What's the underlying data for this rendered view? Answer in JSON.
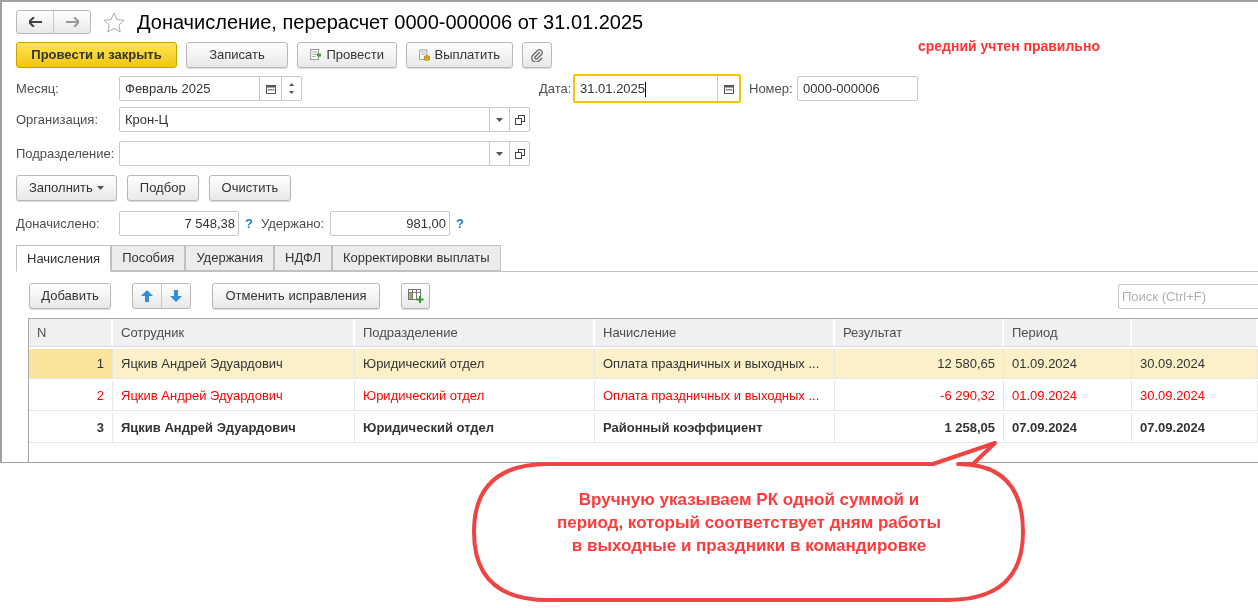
{
  "window": {
    "title": "Доначисление, перерасчет 0000-000006 от 31.01.2025"
  },
  "toolbar": {
    "buttons": [
      {
        "label": "Провести и закрыть",
        "kind": "primary"
      },
      {
        "label": "Записать",
        "kind": "plain"
      },
      {
        "label": "Провести",
        "kind": "post"
      },
      {
        "label": "Выплатить",
        "kind": "pay"
      },
      {
        "kind": "attach"
      }
    ]
  },
  "note": "средний учтен правильно",
  "fields": {
    "month": {
      "label": "Месяц:",
      "value": "Февраль 2025"
    },
    "date": {
      "label": "Дата:",
      "value": "31.01.2025",
      "focused": true
    },
    "number": {
      "label": "Номер:",
      "value": "0000-000006"
    },
    "organization": {
      "label": "Организация:",
      "value": "Крон-Ц"
    },
    "department": {
      "label": "Подразделение:"
    }
  },
  "fill_buttons": [
    {
      "label": "Заполнить",
      "dropdown": true
    },
    {
      "label": "Подбор",
      "dropdown": false
    },
    {
      "label": "Очистить",
      "dropdown": false
    }
  ],
  "totals": [
    {
      "label": "Доначислено:",
      "value": "7 548,38",
      "hint": "?"
    },
    {
      "label": "Удержано:",
      "value": "981,00",
      "hint": "?"
    }
  ],
  "tabs": [
    {
      "label": "Начисления",
      "selected": true
    },
    {
      "label": "Пособия",
      "selected": false
    },
    {
      "label": "Удержания",
      "selected": false
    },
    {
      "label": "НДФЛ",
      "selected": false
    },
    {
      "label": "Корректировки выплаты",
      "selected": false
    }
  ],
  "table_toolbar": {
    "add": "Добавить",
    "undo": "Отменить исправления",
    "search_placeholder": "Поиск (Ctrl+F)"
  },
  "table": {
    "columns": [
      "N",
      "Сотрудник",
      "Подразделение",
      "Начисление",
      "Результат",
      "Период",
      ""
    ],
    "rows": [
      {
        "selected": true,
        "kind": "regular",
        "cells": [
          "1",
          "Яцкив Андрей Эдуардович",
          "Юридический отдел",
          "Оплата праздничных и выходных ...",
          "12 580,65",
          "01.09.2024",
          "30.09.2024"
        ]
      },
      {
        "selected": false,
        "kind": "reversal",
        "cells": [
          "2",
          "Яцкив Андрей Эдуардович",
          "Юридический отдел",
          "Оплата праздничных и выходных ...",
          "-6 290,32",
          "01.09.2024",
          "30.09.2024"
        ]
      },
      {
        "selected": false,
        "kind": "manual",
        "cells": [
          "3",
          "Яцкив Андрей Эдуардович",
          "Юридический отдел",
          "Районный коэффициент",
          "1 258,05",
          "07.09.2024",
          "07.09.2024"
        ]
      }
    ]
  },
  "callout": "Вручную указываем РК одной суммой и период, который соответствует дням работы в выходные и праздники в командировке"
}
